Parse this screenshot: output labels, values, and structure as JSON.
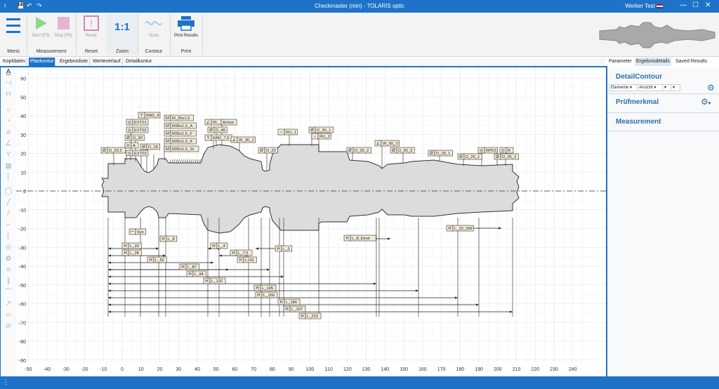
{
  "window": {
    "title": "Checkmaster (min) - TOLARIS optic",
    "user": "Werker Test",
    "quick_icons": {
      "save": "💾",
      "undo": "↶",
      "redo": "↷"
    },
    "min_icon": "—",
    "max_icon": "☐",
    "close_icon": "✕"
  },
  "ribbon": {
    "menu": {
      "label": "Menü"
    },
    "measurement": {
      "label": "Measurement",
      "start": "Start (F5)",
      "stop": "Stop (F6)"
    },
    "reset": {
      "label": "Reset",
      "button": "Reset"
    },
    "zoom": {
      "label": "Zoom",
      "value": "1:1"
    },
    "contour": {
      "label": "Contour",
      "scan": "Scan"
    },
    "print": {
      "label": "Print",
      "button": "Print Results"
    }
  },
  "tabs": [
    "Kopfdaten",
    "Plankontur",
    "Ergebnisliste",
    "Werteverlauf",
    "Detailkontur"
  ],
  "active_tab": "Plankontur",
  "right_panel": {
    "tabs": [
      "Parameter",
      "Ergebnisdetails",
      "Saved Results"
    ],
    "active_tab": "Ergebnisdetails",
    "detail_contour": {
      "title": "DetailContour",
      "elemente": "Elemente",
      "ansicht": "Ansicht"
    },
    "pruefmerkmal": {
      "title": "Prüfmerkmal"
    },
    "measurement": {
      "title": "Measurement"
    }
  },
  "plot": {
    "x_ticks": [
      "-50",
      "-40",
      "-30",
      "-20",
      "-10",
      "0",
      "10",
      "20",
      "30",
      "40",
      "50",
      "60",
      "70",
      "80",
      "90",
      "100",
      "110",
      "120",
      "130",
      "140",
      "150",
      "160",
      "170",
      "180",
      "190",
      "200",
      "210",
      "220",
      "230",
      "240"
    ],
    "y_ticks": [
      "60",
      "50",
      "40",
      "30",
      "20",
      "10",
      "0",
      "-10",
      "-20",
      "-30",
      "-40",
      "-50",
      "-60",
      "-70",
      "-80",
      "-90"
    ],
    "upper_labels": [
      {
        "id": "rad4",
        "sym": "Y",
        "text": "RAD_4"
      },
      {
        "id": "ext01",
        "sym": "◎",
        "text": "EXT01"
      },
      {
        "id": "ext02",
        "sym": "◎",
        "text": "EXT02"
      },
      {
        "id": "d30",
        "sym": "Ø",
        "text": "D_30"
      },
      {
        "id": "a",
        "sym": "◎",
        "text": "A"
      },
      {
        "id": "d18",
        "sym": "Ø",
        "text": "D_18"
      },
      {
        "id": "ext03",
        "sym": "◎",
        "text": "EXT03"
      },
      {
        "id": "d295",
        "sym": "Ø",
        "text": "D_29,5"
      },
      {
        "id": "m35a",
        "sym": "M",
        "text": "M_35x1,5"
      },
      {
        "id": "m35b",
        "sym": "M",
        "text": "M35x1,5_A"
      },
      {
        "id": "m35c",
        "sym": "M",
        "text": "M35x1,5_F"
      },
      {
        "id": "m35d",
        "sym": "M",
        "text": "M35x1,5_K"
      },
      {
        "id": "m35e",
        "sym": "M",
        "text": "M35x1,5_St"
      },
      {
        "id": "rl1",
        "sym": "∠",
        "text": "RL_1"
      },
      {
        "id": "achse",
        "sym": "",
        "text": "Achse"
      },
      {
        "id": "d48",
        "sym": "Ø",
        "text": "D_48"
      },
      {
        "id": "rad75",
        "sym": "Y",
        "text": "RAD_7,5"
      },
      {
        "id": "w301",
        "sym": "∠",
        "text": "W_30_1"
      },
      {
        "id": "d20",
        "sym": "Ø",
        "text": "D_20"
      },
      {
        "id": "ru1",
        "sym": "○",
        "text": "RU_1"
      },
      {
        "id": "d301",
        "sym": "Ø",
        "text": "D_30_1"
      },
      {
        "id": "ru2",
        "sym": "○",
        "text": "RU_2"
      },
      {
        "id": "d302",
        "sym": "Ø",
        "text": "D_30_2"
      },
      {
        "id": "w60v",
        "sym": "∠",
        "text": "W_60_V"
      },
      {
        "id": "d303",
        "sym": "Ø",
        "text": "D_30_3"
      },
      {
        "id": "d181",
        "sym": "Ø",
        "text": "D_18_1"
      },
      {
        "id": "d261",
        "sym": "Ø",
        "text": "D_26_1"
      },
      {
        "id": "rpd1",
        "sym": "◎",
        "text": "RPD1"
      },
      {
        "id": "b",
        "sym": "◎",
        "text": "B"
      },
      {
        "id": "d262",
        "sym": "Ø",
        "text": "D_26_2"
      }
    ],
    "lower_labels": [
      {
        "id": "sys",
        "sym": "⊢",
        "text": "Sys"
      },
      {
        "id": "l8",
        "sym": "H",
        "text": "L_8"
      },
      {
        "id": "l20",
        "sym": "H",
        "text": "L_20"
      },
      {
        "id": "l28",
        "sym": "H",
        "text": "L_28"
      },
      {
        "id": "l4",
        "sym": "H",
        "text": "L_4"
      },
      {
        "id": "l75",
        "sym": "H",
        "text": "L_7,5"
      },
      {
        "id": "l3",
        "sym": "H",
        "text": "L_3"
      },
      {
        "id": "l52",
        "sym": "H",
        "text": "L_52"
      },
      {
        "id": "l101",
        "sym": "H",
        "text": "L101"
      },
      {
        "id": "l87",
        "sym": "H",
        "text": "L_87"
      },
      {
        "id": "l94",
        "sym": "H",
        "text": "L_94"
      },
      {
        "id": "l8einst",
        "sym": "H",
        "text": "L_8_Einst"
      },
      {
        "id": "l10sw",
        "sym": "H",
        "text": "L_10_SW"
      },
      {
        "id": "l132",
        "sym": "H",
        "text": "L_132"
      },
      {
        "id": "l145",
        "sym": "H",
        "text": "L_145"
      },
      {
        "id": "l166",
        "sym": "H",
        "text": "L_166"
      },
      {
        "id": "l186",
        "sym": "H",
        "text": "L_186"
      },
      {
        "id": "l197",
        "sym": "H",
        "text": "L_197"
      },
      {
        "id": "l215",
        "sym": "H",
        "text": "L_215"
      }
    ]
  },
  "colors": {
    "accent": "#1e73c8",
    "part": "#dcdcdc",
    "part_edge": "#333333",
    "label_bg": "#f4ecd9",
    "grid": "#e4e7ea",
    "panel_head": "#2e6ea6"
  }
}
